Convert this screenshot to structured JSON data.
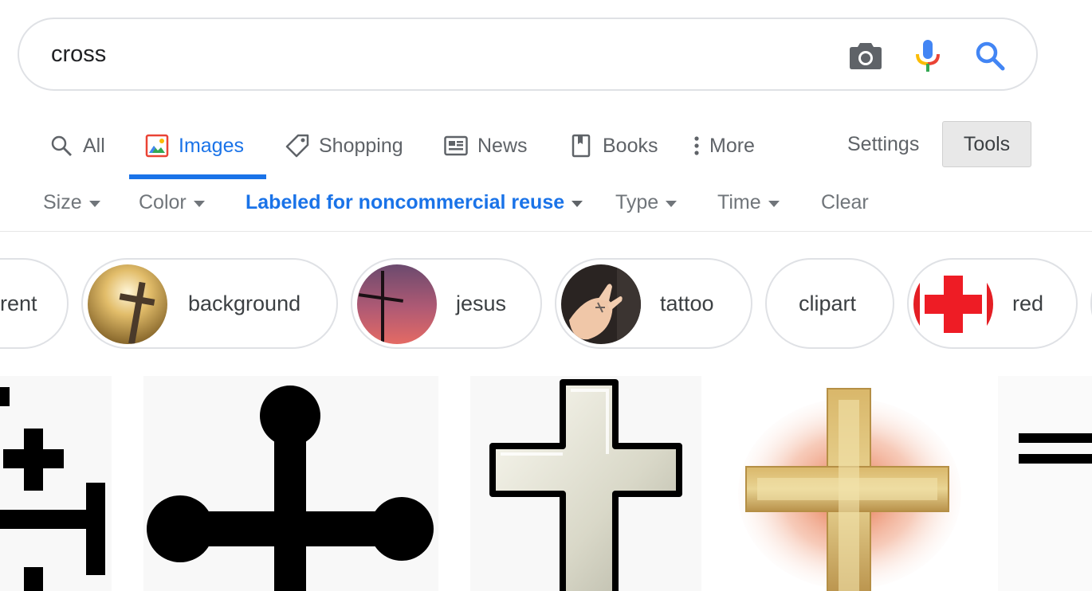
{
  "search": {
    "query": "cross",
    "camera_icon": "camera-icon",
    "mic_icon": "mic-icon",
    "search_icon": "search-icon"
  },
  "nav": {
    "tabs": [
      {
        "label": "All",
        "icon": "search-icon"
      },
      {
        "label": "Images",
        "icon": "image-icon",
        "active": true
      },
      {
        "label": "Shopping",
        "icon": "tag-icon"
      },
      {
        "label": "News",
        "icon": "newspaper-icon"
      },
      {
        "label": "Books",
        "icon": "book-icon"
      },
      {
        "label": "More",
        "icon": "more-vert-icon"
      }
    ],
    "settings_label": "Settings",
    "tools_label": "Tools"
  },
  "filters": [
    {
      "label": "Size"
    },
    {
      "label": "Color"
    },
    {
      "label": "Labeled for noncommercial reuse",
      "active": true
    },
    {
      "label": "Type"
    },
    {
      "label": "Time"
    },
    {
      "label": "Clear"
    }
  ],
  "chips": [
    {
      "label": "rent"
    },
    {
      "label": "background"
    },
    {
      "label": "jesus"
    },
    {
      "label": "tattoo"
    },
    {
      "label": "clipart"
    },
    {
      "label": "red"
    }
  ],
  "colors": {
    "accent": "#1a73e8",
    "text_secondary": "#5f6368",
    "border": "#dfe1e5"
  }
}
